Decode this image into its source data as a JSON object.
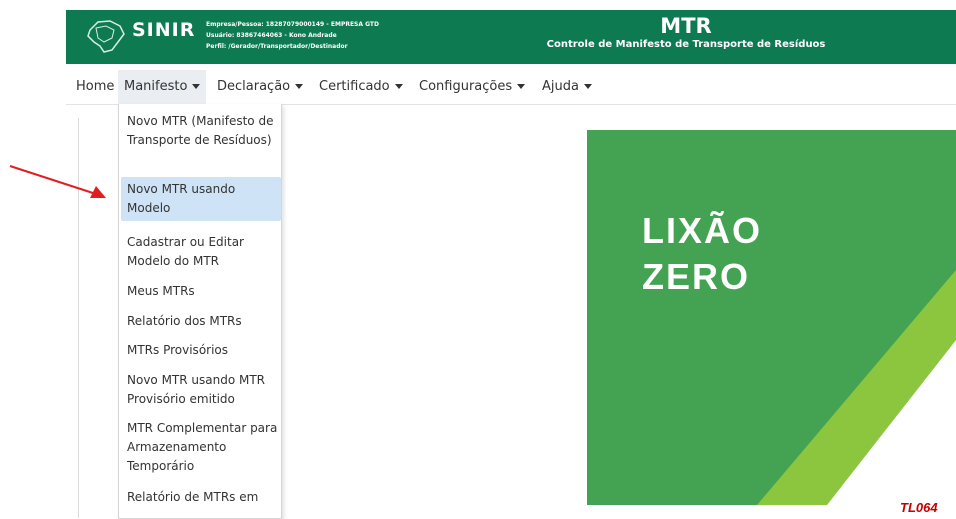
{
  "header": {
    "logo": "SINIR",
    "user_info": [
      "Empresa/Pessoa: 18287079000149 - EMPRESA GTD",
      "Usuário: 83867464063 - Kono Andrade",
      "Perfil: /Gerador/Transportador/Destinador"
    ],
    "app_title": "MTR",
    "app_subtitle": "Controle de Manifesto de Transporte de Resíduos",
    "bg_color": "#0e7a52"
  },
  "menubar": {
    "items": [
      {
        "label": "Home",
        "has_caret": false
      },
      {
        "label": "Manifesto",
        "has_caret": true
      },
      {
        "label": "Declaração",
        "has_caret": true
      },
      {
        "label": "Certificado",
        "has_caret": true
      },
      {
        "label": "Configurações",
        "has_caret": true
      },
      {
        "label": "Ajuda",
        "has_caret": true
      }
    ],
    "active": "Manifesto"
  },
  "dropdown": {
    "items": [
      {
        "label": "Novo MTR (Manifesto de Transporte de Resíduos)"
      },
      {
        "label": "Novo MTR usando Modelo"
      },
      {
        "label": "Cadastrar ou Editar Modelo do MTR"
      },
      {
        "label": "Meus MTRs"
      },
      {
        "label": "Relatório dos MTRs"
      },
      {
        "label": "MTRs Provisórios"
      },
      {
        "label": "Novo MTR usando MTR Provisório emitido"
      },
      {
        "label": "MTR Complementar para Armazenamento Temporário"
      },
      {
        "label": "Relatório de MTRs em"
      }
    ],
    "highlighted": "Novo MTR usando Modelo"
  },
  "banner": {
    "line1": "LIXÃO",
    "line2": "ZERO",
    "color": "#43a352",
    "accent_color": "#8cc63f"
  },
  "annotation": {
    "arrow_color": "#e02020",
    "code": "TL064",
    "code_color": "#c40000"
  }
}
